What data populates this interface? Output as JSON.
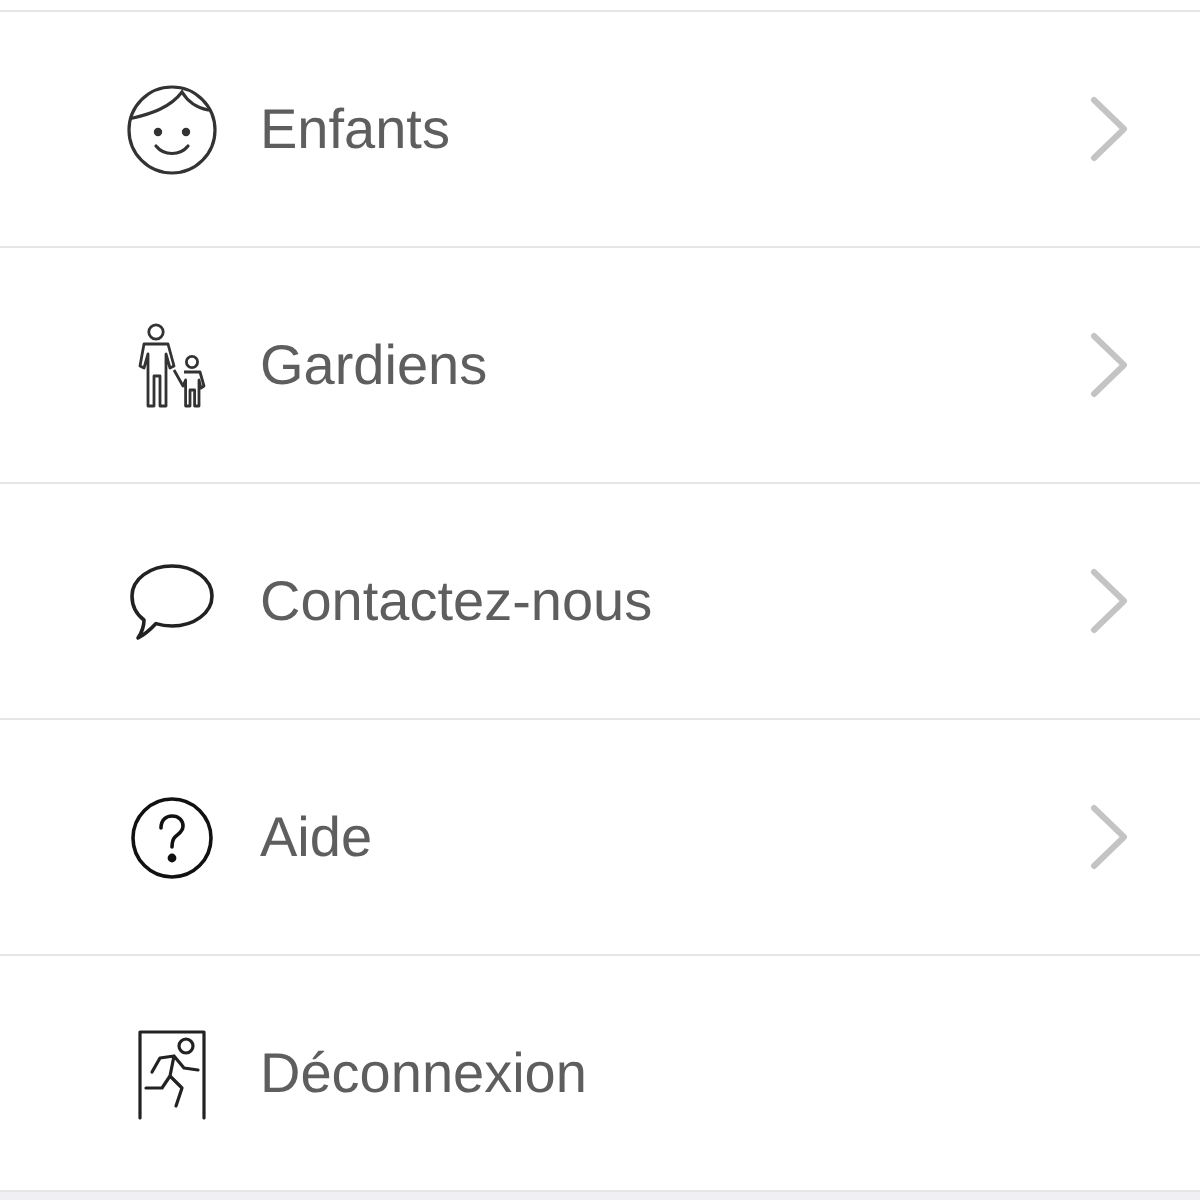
{
  "menu": {
    "items": [
      {
        "label": "Enfants",
        "kind": "link"
      },
      {
        "label": "Gardiens",
        "kind": "link"
      },
      {
        "label": "Contactez-nous",
        "kind": "link"
      },
      {
        "label": "Aide",
        "kind": "link"
      },
      {
        "label": "Déconnexion",
        "kind": "action"
      }
    ]
  }
}
